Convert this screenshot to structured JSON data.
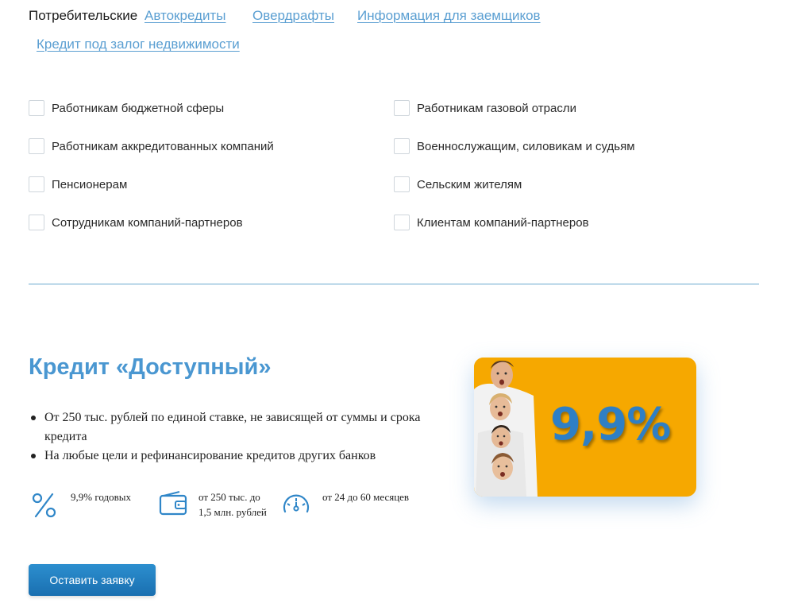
{
  "tabs": [
    {
      "label": "Потребительские",
      "active": true
    },
    {
      "label": "Автокредиты",
      "active": false
    },
    {
      "label": "Овердрафты",
      "active": false
    },
    {
      "label": "Информация для заемщиков",
      "active": false
    },
    {
      "label": "Кредит под залог недвижимости",
      "active": false
    }
  ],
  "filters": [
    {
      "label": "Работникам бюджетной сферы",
      "checked": false
    },
    {
      "label": "Работникам газовой отрасли",
      "checked": false
    },
    {
      "label": "Работникам аккредитованных компаний",
      "checked": false
    },
    {
      "label": "Военнослужащим, силовикам и судьям",
      "checked": false
    },
    {
      "label": "Пенсионерам",
      "checked": false
    },
    {
      "label": "Сельским жителям",
      "checked": false
    },
    {
      "label": "Сотрудникам компаний-партнеров",
      "checked": false
    },
    {
      "label": "Клиентам компаний-партнеров",
      "checked": false
    }
  ],
  "offer": {
    "title": "Кредит «Доступный»",
    "bullets": [
      "От 250 тыс. рублей по единой ставке, не зависящей от суммы и срока кредита",
      "На любые цели и рефинансирование кредитов других банков"
    ],
    "features": [
      {
        "icon": "percent-icon",
        "lines": [
          "9,9% годовых"
        ]
      },
      {
        "icon": "wallet-icon",
        "lines": [
          "от 250 тыс. до",
          "1,5 млн. рублей"
        ]
      },
      {
        "icon": "speedometer-icon",
        "lines": [
          "от 24 до 60 месяцев"
        ]
      }
    ],
    "cta_label": "Оставить заявку",
    "promo_rate": "9,9%"
  },
  "colors": {
    "accent": "#4a97d1",
    "link": "#5b9fd2",
    "promo_bg": "#f6a800",
    "button": "#1f7dc0"
  }
}
